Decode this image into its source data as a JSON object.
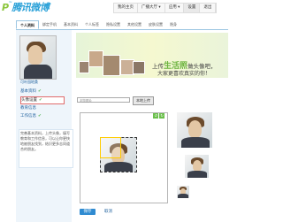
{
  "header": {
    "logo_text": "腾讯微博",
    "nav": [
      "我的主页",
      "广播大厅 ▾",
      "应用 ▾",
      "设置",
      "退出"
    ]
  },
  "tabs": [
    "个人资料",
    "绑定手机",
    "基本资料",
    "个人标签",
    "隐私设置",
    "其他设置",
    "皮肤设置",
    "隐身"
  ],
  "sidebar": {
    "username": "可叶园地桑",
    "menu": [
      {
        "label": "基本资料",
        "checked": true
      },
      {
        "label": "头像设置",
        "checked": true
      },
      {
        "label": "教育信息",
        "checked": false
      },
      {
        "label": "工作信息",
        "checked": true
      }
    ],
    "note": "完善基本资料，上传头像，填写教育和工作信息，可以让你更快地被朋友找到，结识更多志同道合的朋友。"
  },
  "banner": {
    "line1_prefix": "上传",
    "line1_highlight": "生活照",
    "line1_suffix": "做头像吧，",
    "line2": "大家更喜欢真实的你！"
  },
  "upload": {
    "file_placeholder": "浏览图片",
    "upload_button": "本地上传"
  },
  "crop": {
    "icons": [
      "rotate-left-icon",
      "rotate-right-icon"
    ]
  },
  "actions": {
    "save": "保存",
    "cancel": "取消"
  },
  "colors": {
    "accent": "#2aa1d8",
    "green": "#6cb33e",
    "link": "#1b5e9c",
    "button": "#2f8bd1"
  }
}
